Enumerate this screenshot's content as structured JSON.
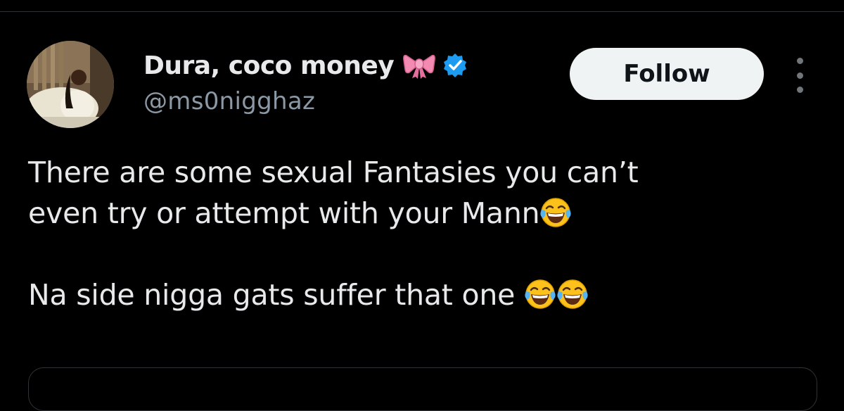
{
  "author": {
    "display_name": "Dura, coco money",
    "handle": "@ms0nigghaz",
    "verified": true,
    "name_emoji": "bow-icon"
  },
  "actions": {
    "follow_label": "Follow"
  },
  "tweet": {
    "line1": "There are some sexual Fantasies you can’t",
    "line2": "even try or attempt with your Mann",
    "line3": "Na side nigga gats suffer that one",
    "emoji": "face-with-tears-of-joy"
  },
  "colors": {
    "background": "#000000",
    "text": "#e7e9ea",
    "secondary_text": "#8b98a5",
    "verified": "#1d9bf0",
    "follow_button_bg": "#eff3f4"
  }
}
